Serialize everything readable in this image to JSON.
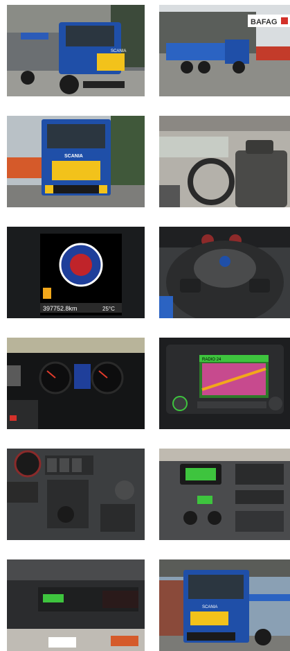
{
  "gallery": {
    "photos": [
      {
        "subject": "truck-front-left"
      },
      {
        "subject": "truck-side-building"
      },
      {
        "subject": "truck-front"
      },
      {
        "subject": "cab-interior-seats"
      },
      {
        "subject": "dash-display-logo",
        "odometer": "397752.8km",
        "temperature": "25°C"
      },
      {
        "subject": "steering-wheel"
      },
      {
        "subject": "instrument-cluster"
      },
      {
        "subject": "navigation-radio",
        "radio_station": "RADIO 24"
      },
      {
        "subject": "switch-panel"
      },
      {
        "subject": "center-console"
      },
      {
        "subject": "tachograph"
      },
      {
        "subject": "truck-front-left-2"
      }
    ],
    "sign_text": "BAFAG",
    "truck_brand": "SCANIA",
    "colors": {
      "truck_blue": "#1f4fa8",
      "truck_yellow": "#f2c21b",
      "display_green": "#3ec43e"
    }
  }
}
